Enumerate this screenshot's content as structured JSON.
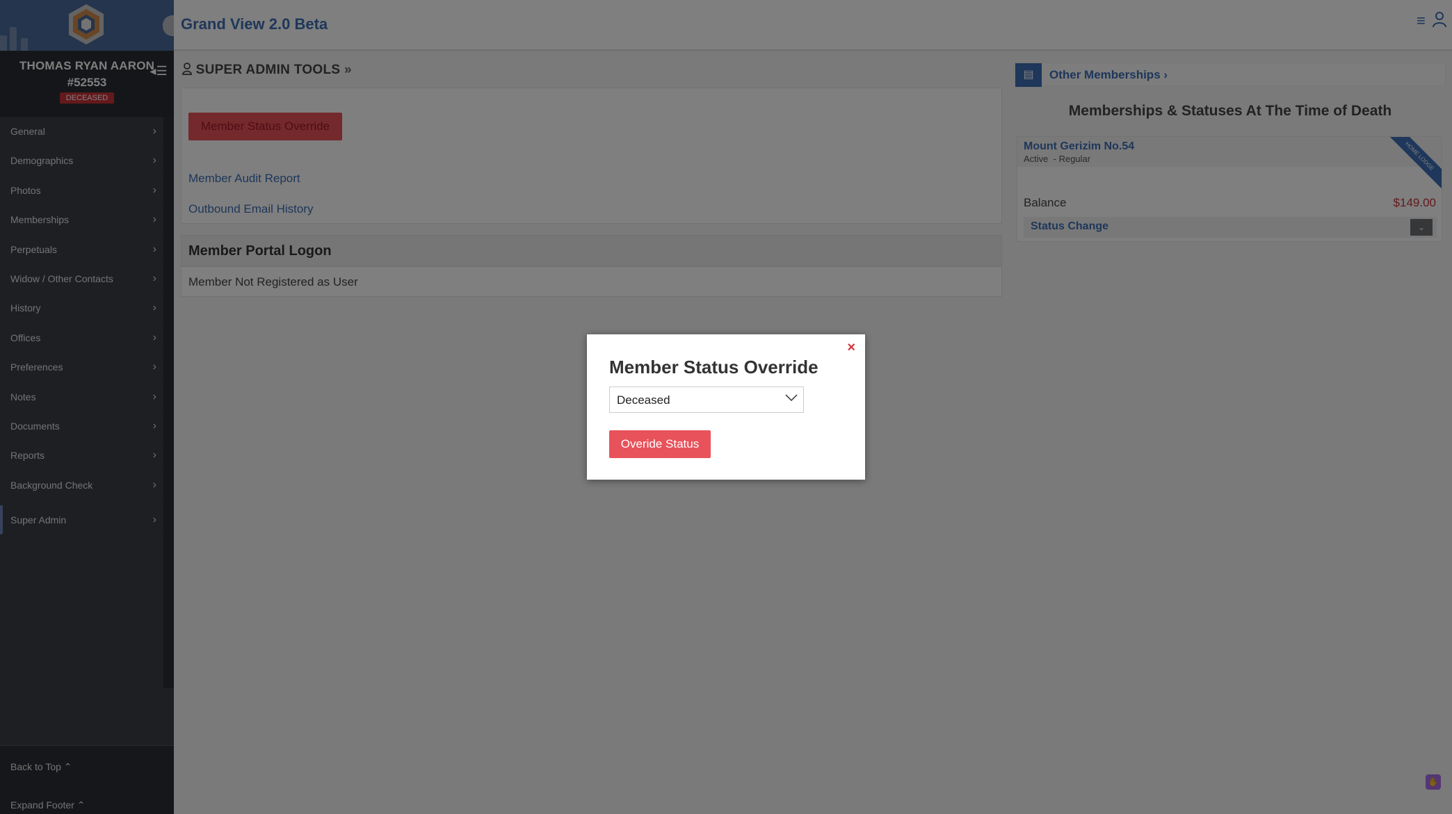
{
  "app": {
    "title": "Grand View 2.0 Beta"
  },
  "member": {
    "name": "THOMAS RYAN AARON",
    "id": "#52553",
    "status_badge": "DECEASED"
  },
  "sidebar": {
    "items": [
      {
        "label": "General"
      },
      {
        "label": "Demographics"
      },
      {
        "label": "Photos"
      },
      {
        "label": "Memberships"
      },
      {
        "label": "Perpetuals"
      },
      {
        "label": "Widow / Other Contacts"
      },
      {
        "label": "History"
      },
      {
        "label": "Offices"
      },
      {
        "label": "Preferences"
      },
      {
        "label": "Notes"
      },
      {
        "label": "Documents"
      },
      {
        "label": "Reports"
      },
      {
        "label": "Background Check"
      },
      {
        "label": "Super Admin"
      }
    ],
    "back_to_top": "Back to Top",
    "expand_footer": "Expand Footer"
  },
  "main": {
    "section_title": "SUPER ADMIN TOOLS",
    "status_override_button": "Member Status Override",
    "links": {
      "audit_report": "Member Audit Report",
      "email_history": "Outbound Email History"
    },
    "portal": {
      "heading": "Member Portal Logon",
      "status": "Member Not Registered as User"
    }
  },
  "right": {
    "other_memberships": "Other Memberships",
    "section_title": "Memberships & Statuses At The Time of Death",
    "lodge": {
      "name": "Mount Gerizim No.54",
      "status": "Active",
      "type": "- Regular",
      "ribbon": "HOME LODGE"
    },
    "balance": {
      "label": "Balance",
      "value": "$149.00"
    },
    "status_change": "Status Change"
  },
  "modal": {
    "title": "Member Status Override",
    "select_value": "Deceased",
    "button": "Overide Status",
    "close": "×"
  },
  "colors": {
    "accent": "#3d6fb4",
    "danger": "#e8525b",
    "sidebar": "#3b3f46"
  },
  "icons": [
    "logo-icon",
    "user-tie-icon",
    "double-chevron-right-icon",
    "id-card-icon",
    "menu-icon",
    "user-icon",
    "close-icon",
    "chevron-down-icon",
    "chat-icon"
  ]
}
